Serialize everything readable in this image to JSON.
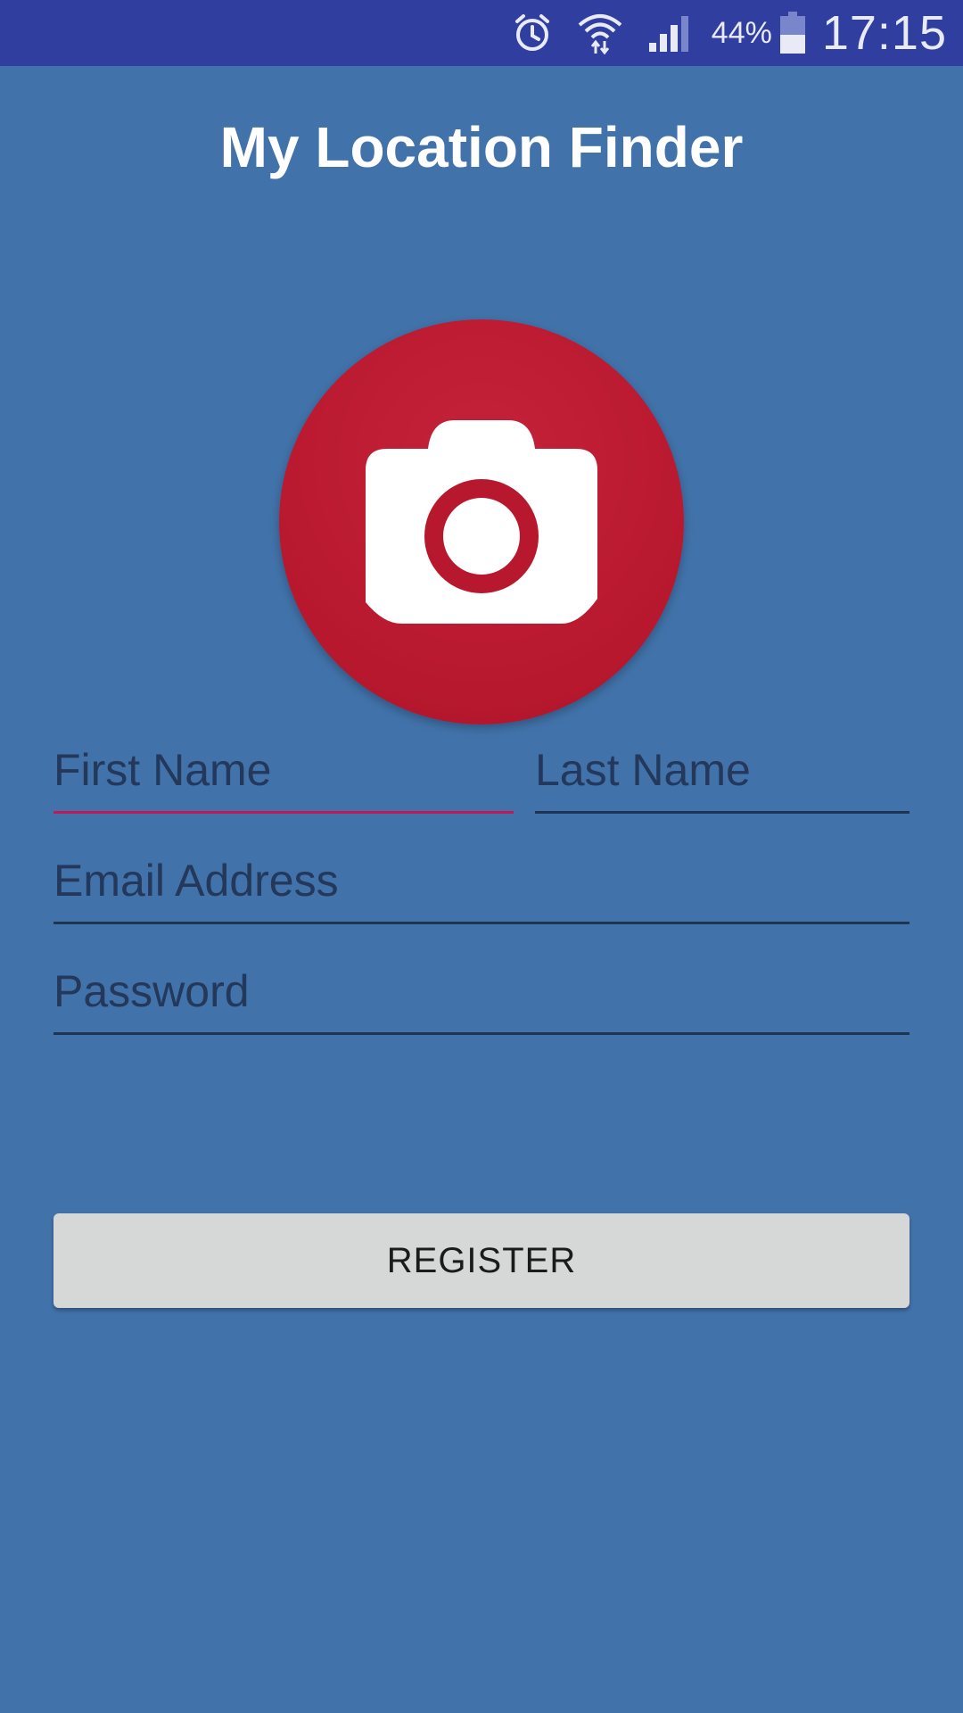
{
  "status_bar": {
    "battery_percent": "44%",
    "time": "17:15",
    "icons": [
      "alarm-icon",
      "wifi-icon",
      "signal-icon",
      "battery-icon"
    ]
  },
  "app": {
    "title": "My Location Finder"
  },
  "photo": {
    "icon": "camera-icon",
    "color": "#B8182E"
  },
  "form": {
    "first_name": {
      "placeholder": "First Name",
      "value": ""
    },
    "last_name": {
      "placeholder": "Last Name",
      "value": ""
    },
    "email": {
      "placeholder": "Email Address",
      "value": ""
    },
    "password": {
      "placeholder": "Password",
      "value": ""
    },
    "register_label": "REGISTER"
  },
  "colors": {
    "background": "#4172A9",
    "status_bar": "#303F9F",
    "focus_accent": "#C2185B"
  }
}
